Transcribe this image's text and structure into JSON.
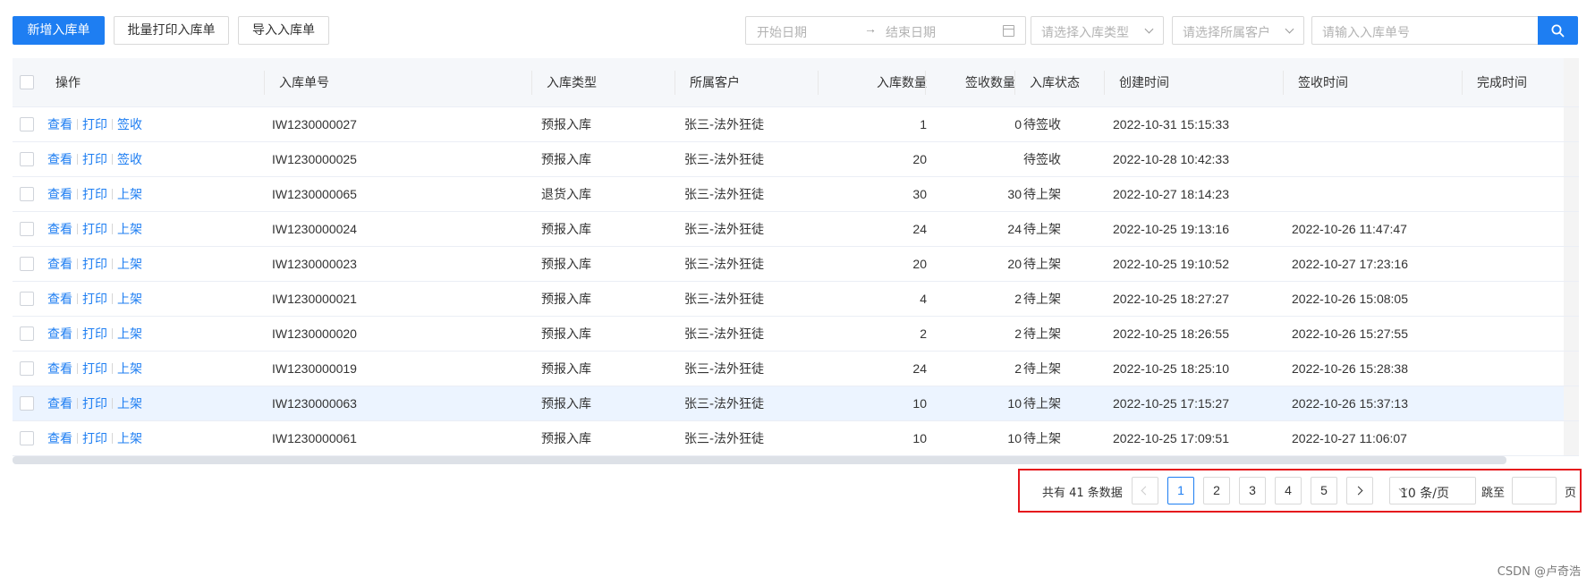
{
  "toolbar": {
    "new_label": "新增入库单",
    "batch_print_label": "批量打印入库单",
    "import_label": "导入入库单",
    "date_start_placeholder": "开始日期",
    "date_separator": "→",
    "date_end_placeholder": "结束日期",
    "type_placeholder": "请选择入库类型",
    "customer_placeholder": "请选择所属客户",
    "order_placeholder": "请输入入库单号",
    "accent_color": "#1e7ef2"
  },
  "table": {
    "columns": {
      "ops": "操作",
      "order_no": "入库单号",
      "type": "入库类型",
      "customer": "所属客户",
      "qty": "入库数量",
      "signed_qty": "签收数量",
      "status": "入库状态",
      "created": "创建时间",
      "signed": "签收时间",
      "completed": "完成时间"
    },
    "rows": [
      {
        "actions": [
          "查看",
          "打印",
          "签收"
        ],
        "order_no": "IW1230000027",
        "type": "预报入库",
        "customer": "张三-法外狂徒",
        "qty": "1",
        "signed_qty": "0",
        "status": "待签收",
        "created": "2022-10-31 15:15:33",
        "signed": "",
        "completed": ""
      },
      {
        "actions": [
          "查看",
          "打印",
          "签收"
        ],
        "order_no": "IW1230000025",
        "type": "预报入库",
        "customer": "张三-法外狂徒",
        "qty": "20",
        "signed_qty": "",
        "status": "待签收",
        "created": "2022-10-28 10:42:33",
        "signed": "",
        "completed": ""
      },
      {
        "actions": [
          "查看",
          "打印",
          "上架"
        ],
        "order_no": "IW1230000065",
        "type": "退货入库",
        "customer": "张三-法外狂徒",
        "qty": "30",
        "signed_qty": "30",
        "status": "待上架",
        "created": "2022-10-27 18:14:23",
        "signed": "",
        "completed": ""
      },
      {
        "actions": [
          "查看",
          "打印",
          "上架"
        ],
        "order_no": "IW1230000024",
        "type": "预报入库",
        "customer": "张三-法外狂徒",
        "qty": "24",
        "signed_qty": "24",
        "status": "待上架",
        "created": "2022-10-25 19:13:16",
        "signed": "2022-10-26 11:47:47",
        "completed": ""
      },
      {
        "actions": [
          "查看",
          "打印",
          "上架"
        ],
        "order_no": "IW1230000023",
        "type": "预报入库",
        "customer": "张三-法外狂徒",
        "qty": "20",
        "signed_qty": "20",
        "status": "待上架",
        "created": "2022-10-25 19:10:52",
        "signed": "2022-10-27 17:23:16",
        "completed": ""
      },
      {
        "actions": [
          "查看",
          "打印",
          "上架"
        ],
        "order_no": "IW1230000021",
        "type": "预报入库",
        "customer": "张三-法外狂徒",
        "qty": "4",
        "signed_qty": "2",
        "status": "待上架",
        "created": "2022-10-25 18:27:27",
        "signed": "2022-10-26 15:08:05",
        "completed": ""
      },
      {
        "actions": [
          "查看",
          "打印",
          "上架"
        ],
        "order_no": "IW1230000020",
        "type": "预报入库",
        "customer": "张三-法外狂徒",
        "qty": "2",
        "signed_qty": "2",
        "status": "待上架",
        "created": "2022-10-25 18:26:55",
        "signed": "2022-10-26 15:27:55",
        "completed": ""
      },
      {
        "actions": [
          "查看",
          "打印",
          "上架"
        ],
        "order_no": "IW1230000019",
        "type": "预报入库",
        "customer": "张三-法外狂徒",
        "qty": "24",
        "signed_qty": "2",
        "status": "待上架",
        "created": "2022-10-25 18:25:10",
        "signed": "2022-10-26 15:28:38",
        "completed": ""
      },
      {
        "actions": [
          "查看",
          "打印",
          "上架"
        ],
        "order_no": "IW1230000063",
        "type": "预报入库",
        "customer": "张三-法外狂徒",
        "qty": "10",
        "signed_qty": "10",
        "status": "待上架",
        "created": "2022-10-25 17:15:27",
        "signed": "2022-10-26 15:37:13",
        "completed": "",
        "highlighted": true
      },
      {
        "actions": [
          "查看",
          "打印",
          "上架"
        ],
        "order_no": "IW1230000061",
        "type": "预报入库",
        "customer": "张三-法外狂徒",
        "qty": "10",
        "signed_qty": "10",
        "status": "待上架",
        "created": "2022-10-25 17:09:51",
        "signed": "2022-10-27 11:06:07",
        "completed": ""
      }
    ]
  },
  "pagination": {
    "total_text": "共有 41 条数据",
    "pages": [
      "1",
      "2",
      "3",
      "4",
      "5"
    ],
    "current_page": "1",
    "page_size": "10 条/页",
    "jump_label": "跳至",
    "page_label": "页",
    "frame_color": "#e5161c"
  },
  "watermark": "CSDN @卢奇浩"
}
